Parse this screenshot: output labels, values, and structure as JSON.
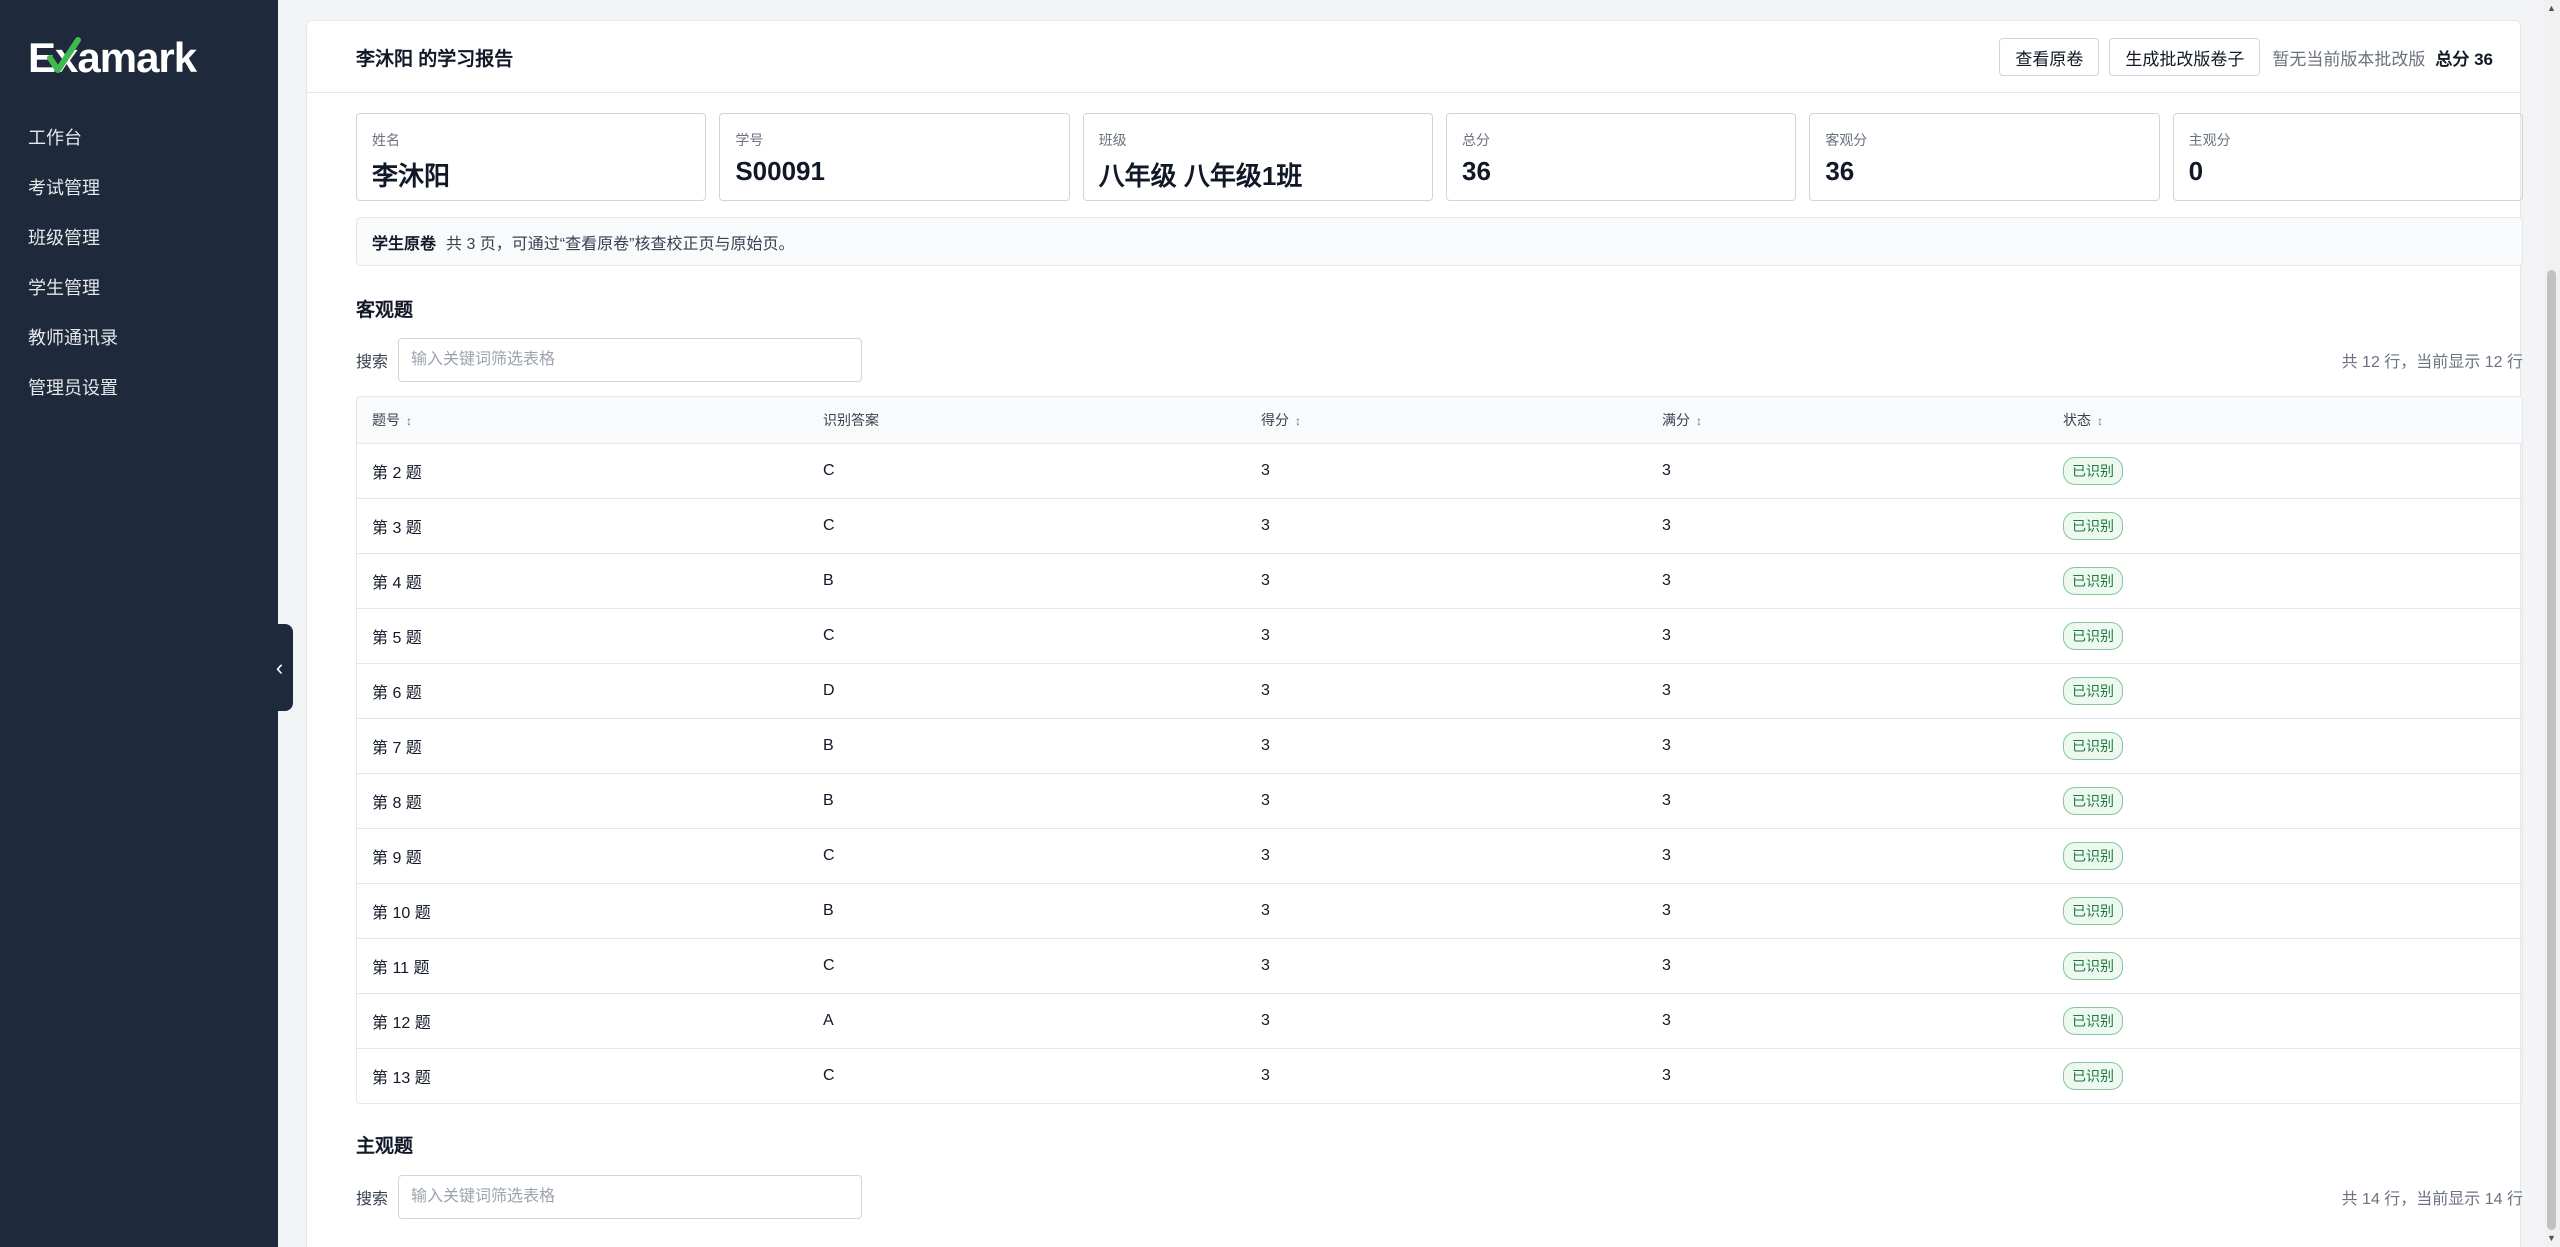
{
  "app": {
    "logo": "Examark"
  },
  "sidebar": {
    "items": [
      {
        "label": "工作台"
      },
      {
        "label": "考试管理"
      },
      {
        "label": "班级管理"
      },
      {
        "label": "学生管理"
      },
      {
        "label": "教师通讯录"
      },
      {
        "label": "管理员设置"
      }
    ],
    "collapse_glyph": "‹"
  },
  "header": {
    "title": "李沐阳 的学习报告",
    "view_original_label": "查看原卷",
    "generate_label": "生成批改版卷子",
    "note": "暂无当前版本批改版",
    "total": "总分 36"
  },
  "stats": [
    {
      "label": "姓名",
      "value": "李沐阳"
    },
    {
      "label": "学号",
      "value": "S00091"
    },
    {
      "label": "班级",
      "value": "八年级 八年级1班"
    },
    {
      "label": "总分",
      "value": "36"
    },
    {
      "label": "客观分",
      "value": "36"
    },
    {
      "label": "主观分",
      "value": "0"
    }
  ],
  "notice": {
    "title": "学生原卷",
    "text": "共 3 页，可通过“查看原卷”核查校正页与原始页。"
  },
  "objective": {
    "title": "客观题",
    "search_label": "搜索",
    "search_placeholder": "输入关键词筛选表格",
    "row_count": "共 12 行，当前显示 12 行",
    "columns": [
      "题号",
      "识别答案",
      "得分",
      "满分",
      "状态"
    ],
    "sort_glyph": "↕",
    "rows": [
      [
        "第 2 题",
        "C",
        "3",
        "3",
        "已识别"
      ],
      [
        "第 3 题",
        "C",
        "3",
        "3",
        "已识别"
      ],
      [
        "第 4 题",
        "B",
        "3",
        "3",
        "已识别"
      ],
      [
        "第 5 题",
        "C",
        "3",
        "3",
        "已识别"
      ],
      [
        "第 6 题",
        "D",
        "3",
        "3",
        "已识别"
      ],
      [
        "第 7 题",
        "B",
        "3",
        "3",
        "已识别"
      ],
      [
        "第 8 题",
        "B",
        "3",
        "3",
        "已识别"
      ],
      [
        "第 9 题",
        "C",
        "3",
        "3",
        "已识别"
      ],
      [
        "第 10 题",
        "B",
        "3",
        "3",
        "已识别"
      ],
      [
        "第 11 题",
        "C",
        "3",
        "3",
        "已识别"
      ],
      [
        "第 12 题",
        "A",
        "3",
        "3",
        "已识别"
      ],
      [
        "第 13 题",
        "C",
        "3",
        "3",
        "已识别"
      ]
    ]
  },
  "subjective": {
    "title": "主观题",
    "search_label": "搜索",
    "search_placeholder": "输入关键词筛选表格",
    "row_count": "共 14 行，当前显示 14 行"
  },
  "colors": {
    "sidebar_bg": "#1e293b",
    "badge_green": "#1f7a3e",
    "logo_check": "#3fb950"
  }
}
